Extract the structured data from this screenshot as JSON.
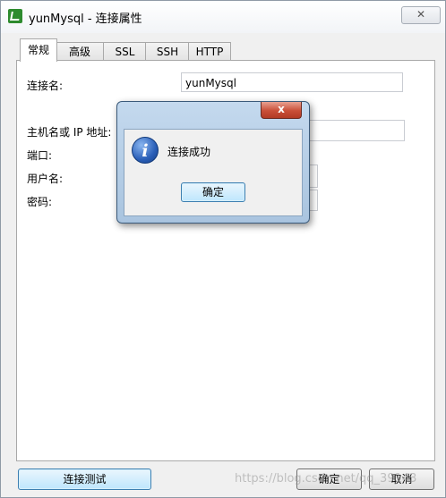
{
  "window": {
    "title": "yunMysql - 连接属性",
    "close_glyph": "✕"
  },
  "tabs": [
    {
      "label": "常规",
      "active": true
    },
    {
      "label": "高级",
      "active": false
    },
    {
      "label": "SSL",
      "active": false
    },
    {
      "label": "SSH",
      "active": false
    },
    {
      "label": "HTTP",
      "active": false
    }
  ],
  "form": {
    "connection_name_label": "连接名:",
    "connection_name_value": "yunMysql",
    "host_label": "主机名或 IP 地址:",
    "port_label": "端口:",
    "username_label": "用户名:",
    "password_label": "密码:"
  },
  "buttons": {
    "test_connection": "连接测试",
    "ok": "确定",
    "cancel": "取消"
  },
  "watermark": "https://blog.csdn.net/qq_39143",
  "dialog": {
    "close_glyph": "x",
    "icon_glyph": "i",
    "message": "连接成功",
    "ok": "确定"
  },
  "colors": {
    "window_bg": "#f0f0f0",
    "panel_bg": "#ffffff",
    "dialog_frame": "#b8cfe6",
    "dialog_close": "#c94f38",
    "info_icon": "#2a5fb8",
    "app_icon": "#2e8b2e"
  },
  "icons": {
    "app": "navicat-app-icon",
    "dialog": "info-icon"
  }
}
